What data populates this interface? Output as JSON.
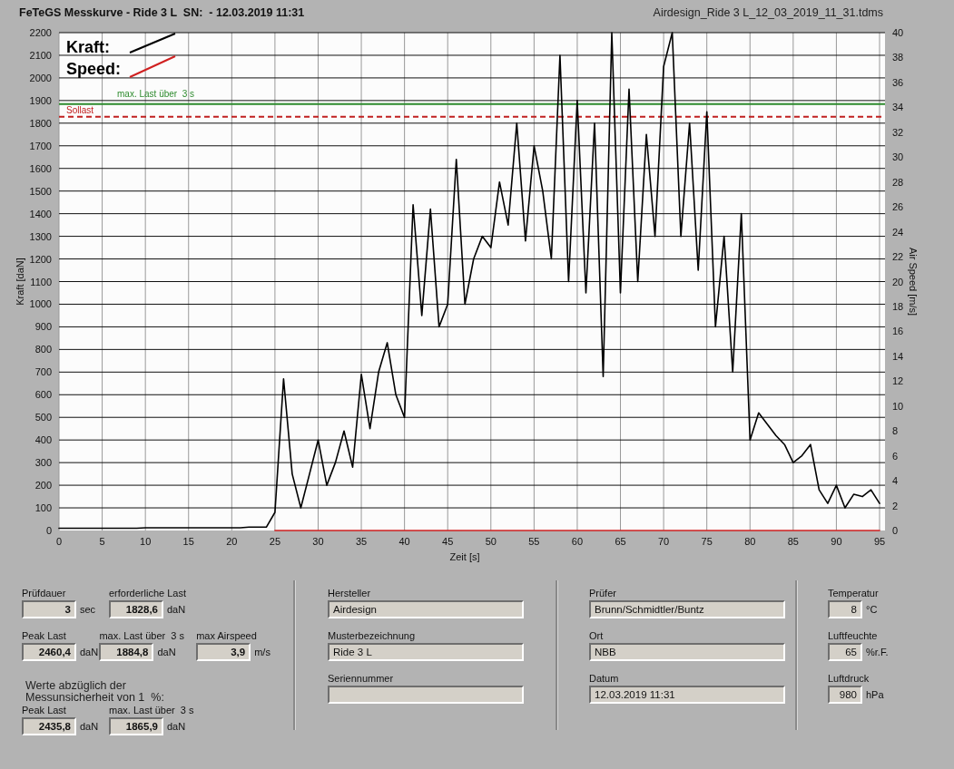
{
  "header": {
    "title": "FeTeGS Messkurve - Ride 3 L  SN:  - 12.03.2019 11:31",
    "file": "Airdesign_Ride 3 L_12_03_2019_11_31.tdms"
  },
  "chart": {
    "chart_data": {
      "type": "line",
      "xlabel": "Zeit [s]",
      "ylabel": "Kraft [daN]",
      "y2label": "Air Speed [m/s]",
      "x": [
        0,
        1,
        2,
        3,
        4,
        5,
        6,
        7,
        8,
        9,
        10,
        11,
        12,
        13,
        14,
        15,
        16,
        17,
        18,
        19,
        20,
        21,
        22,
        23,
        24,
        25,
        26,
        27,
        28,
        29,
        30,
        31,
        32,
        33,
        34,
        35,
        36,
        37,
        38,
        39,
        40,
        41,
        42,
        43,
        44,
        45,
        46,
        47,
        48,
        49,
        50,
        51,
        52,
        53,
        54,
        55,
        56,
        57,
        58,
        59,
        60,
        61,
        62,
        63,
        64,
        65,
        66,
        67,
        68,
        69,
        70,
        71,
        72,
        73,
        74,
        75,
        76,
        77,
        78,
        79,
        80,
        81,
        82,
        83,
        84,
        85,
        86,
        87,
        88,
        89,
        90,
        91,
        92,
        93,
        94,
        95
      ],
      "xlim": [
        0,
        95
      ],
      "ylim": [
        0,
        2200
      ],
      "y2lim": [
        0,
        40
      ],
      "xticks": [
        0,
        5,
        10,
        15,
        20,
        25,
        30,
        35,
        40,
        45,
        50,
        55,
        60,
        65,
        70,
        75,
        80,
        85,
        90,
        95
      ],
      "yticks": [
        0,
        100,
        200,
        300,
        400,
        500,
        600,
        700,
        800,
        900,
        1000,
        1100,
        1200,
        1300,
        1400,
        1500,
        1600,
        1700,
        1800,
        1900,
        2000,
        2100,
        2200
      ],
      "y2ticks": [
        0,
        2,
        4,
        6,
        8,
        10,
        12,
        14,
        16,
        18,
        20,
        22,
        24,
        26,
        28,
        30,
        32,
        34,
        36,
        38,
        40
      ],
      "series": [
        {
          "name": "Kraft:",
          "color": "#000000",
          "values": [
            10,
            10,
            10,
            10,
            10,
            10,
            10,
            10,
            10,
            10,
            12,
            12,
            12,
            12,
            12,
            12,
            12,
            12,
            12,
            12,
            12,
            12,
            15,
            15,
            15,
            80,
            670,
            250,
            100,
            250,
            400,
            200,
            300,
            440,
            280,
            690,
            450,
            700,
            830,
            600,
            500,
            1440,
            950,
            1420,
            900,
            1000,
            1640,
            1000,
            1200,
            1300,
            1250,
            1540,
            1350,
            1800,
            1280,
            1700,
            1500,
            1200,
            2100,
            1100,
            1900,
            1050,
            1800,
            680,
            2200,
            1050,
            1950,
            1100,
            1750,
            1300,
            2050,
            2200,
            1300,
            1800,
            1150,
            1850,
            900,
            1300,
            700,
            1400,
            400,
            520,
            470,
            420,
            380,
            300,
            330,
            380,
            180,
            120,
            200,
            100,
            160,
            150,
            180,
            120
          ]
        },
        {
          "name": "Speed:",
          "color": "#d02020",
          "values": [
            null,
            null,
            null,
            null,
            null,
            null,
            null,
            null,
            null,
            null,
            null,
            null,
            null,
            null,
            null,
            null,
            null,
            null,
            null,
            null,
            null,
            null,
            null,
            null,
            null,
            0,
            0,
            0,
            0,
            0,
            0,
            0,
            0,
            0,
            0,
            0,
            0,
            0,
            0,
            0,
            0,
            0,
            0,
            0,
            0,
            0,
            0,
            0,
            0,
            0,
            0,
            0,
            0,
            0,
            0,
            0,
            0,
            0,
            0,
            0,
            0,
            0,
            0,
            0,
            0,
            0,
            0,
            0,
            0,
            0,
            0,
            0,
            0,
            0,
            0,
            0,
            0,
            0,
            0,
            0,
            0,
            0,
            0,
            0,
            0,
            0,
            0,
            0,
            0,
            0,
            0,
            0,
            0,
            0,
            0,
            0
          ]
        }
      ],
      "grid": true,
      "legend": true,
      "ref_lines": [
        {
          "axis": "y",
          "value": 1884.8,
          "label": "max. Last über  3 s",
          "color": "#2e8b2e"
        },
        {
          "axis": "y",
          "value": 1828.6,
          "label": "Sollast",
          "color": "#c02020"
        }
      ]
    }
  },
  "test_values": [
    [
      {
        "label": "Prüfdauer",
        "value": "3",
        "unit": "sec"
      },
      {
        "label": "erforderliche Last",
        "value": "1828,6",
        "unit": "daN"
      }
    ],
    [
      {
        "label": "Peak Last",
        "value": "2460,4",
        "unit": "daN"
      },
      {
        "label": "max. Last über  3 s",
        "value": "1884,8",
        "unit": "daN"
      },
      {
        "label": "max Airspeed",
        "value": "3,9",
        "unit": "m/s"
      }
    ]
  ],
  "uncertainty_note": "Werte abzüglich der Messunsicherheit von 1  %:",
  "corrected_values": [
    {
      "label": "Peak Last",
      "value": "2435,8",
      "unit": "daN"
    },
    {
      "label": "max. Last über  3 s",
      "value": "1865,9",
      "unit": "daN"
    }
  ],
  "product_fields": [
    {
      "label": "Hersteller",
      "value": "Airdesign"
    },
    {
      "label": "Musterbezeichnung",
      "value": "Ride 3 L"
    },
    {
      "label": "Seriennummer"
    }
  ],
  "test_fields": [
    {
      "label": "Prüfer",
      "value": "Brunn/Schmidtler/Buntz"
    },
    {
      "label": "Ort",
      "value": "NBB"
    },
    {
      "label": "Datum",
      "value": "12.03.2019 11:31"
    }
  ],
  "conditions": [
    {
      "label": "Temperatur",
      "value": "8",
      "unit": "°C"
    },
    {
      "label": "Luftfeuchte",
      "value": "65",
      "unit": "%r.F."
    },
    {
      "label": "Luftdruck",
      "value": "980",
      "unit": "hPa"
    }
  ]
}
